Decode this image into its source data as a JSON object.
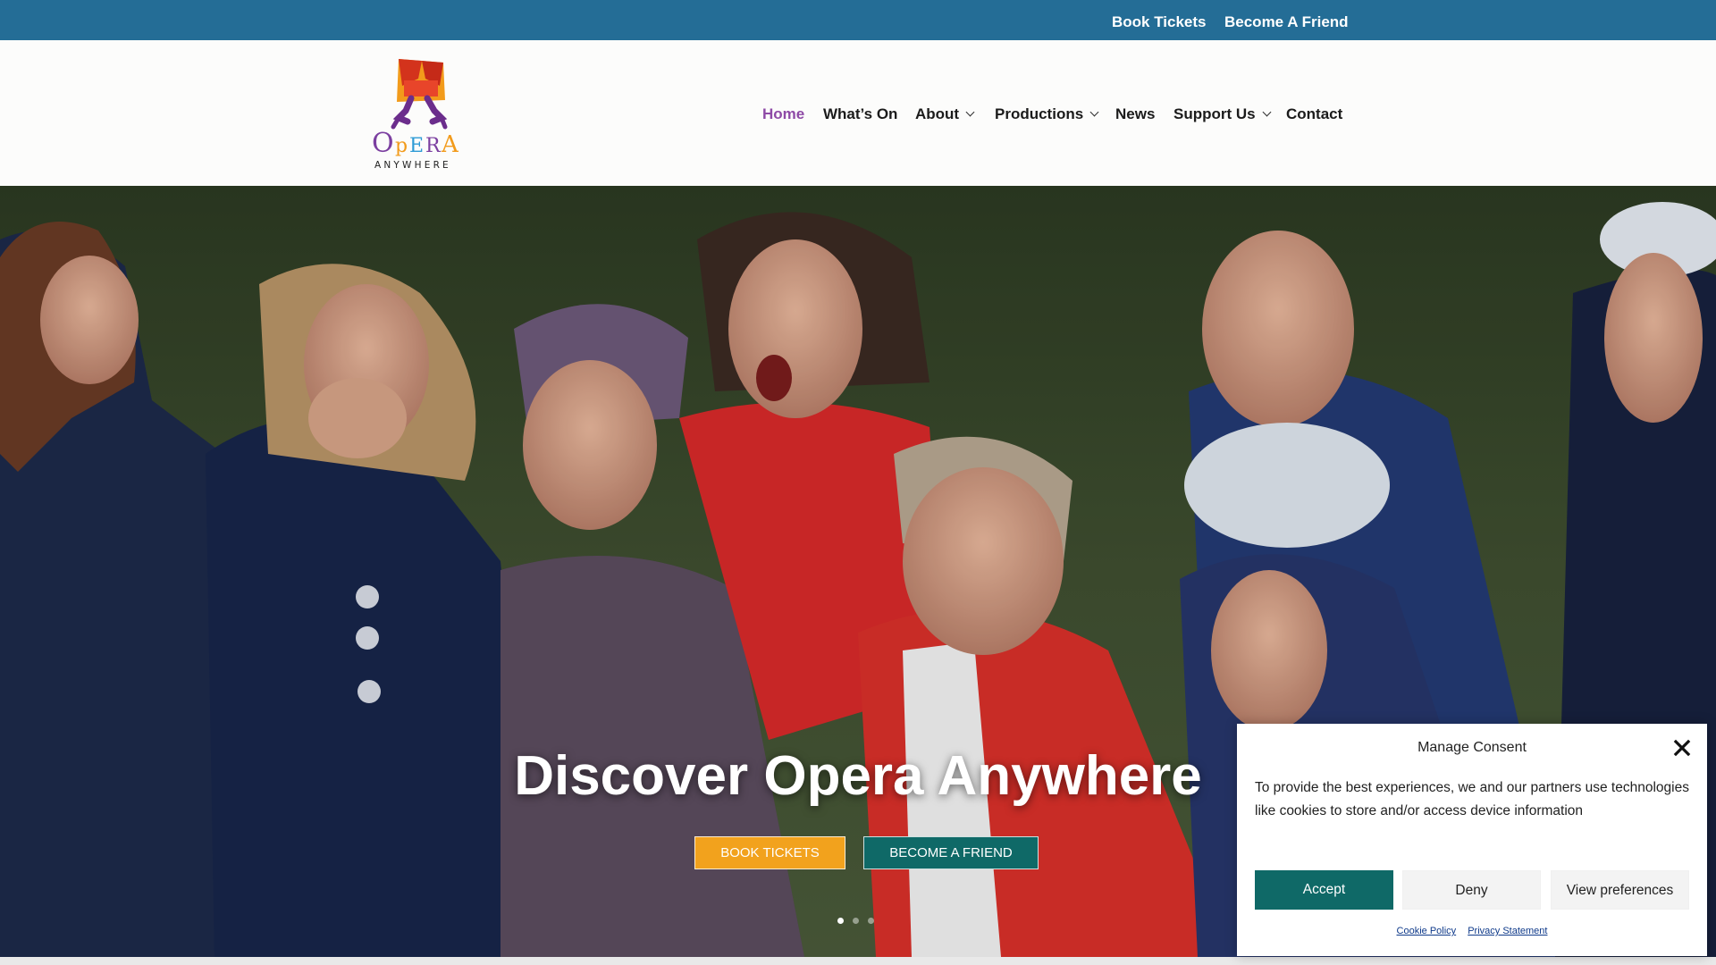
{
  "topbar": {
    "links": [
      "Book Tickets",
      "Become A Friend"
    ]
  },
  "brand": {
    "logo_text": "OpERA",
    "logo_subtext": "ANYWHERE",
    "colors": {
      "topbar": "#246d96",
      "nav_active": "#8e4aa6",
      "teal": "#0f6967",
      "orange": "#f2a21d"
    }
  },
  "nav": {
    "items": [
      {
        "label": "Home",
        "active": true
      },
      {
        "label": "What’s On"
      },
      {
        "label": "About",
        "dropdown": true
      },
      {
        "label": "Productions",
        "dropdown": true
      },
      {
        "label": "News"
      },
      {
        "label": "Support Us",
        "dropdown": true
      },
      {
        "label": "Contact"
      }
    ]
  },
  "hero": {
    "title": "Discover Opera Anywhere",
    "buttons": [
      "BOOK TICKETS",
      "BECOME A FRIEND"
    ],
    "slides": 3,
    "active_slide": 1
  },
  "consent": {
    "title": "Manage Consent",
    "text": "To provide the best experiences, we and our partners use technologies like cookies to store and/or access device information",
    "buttons": {
      "accept": "Accept",
      "deny": "Deny",
      "preferences": "View preferences"
    },
    "links": [
      "Cookie Policy",
      "Privacy Statement"
    ],
    "close_icon": "close-icon"
  }
}
